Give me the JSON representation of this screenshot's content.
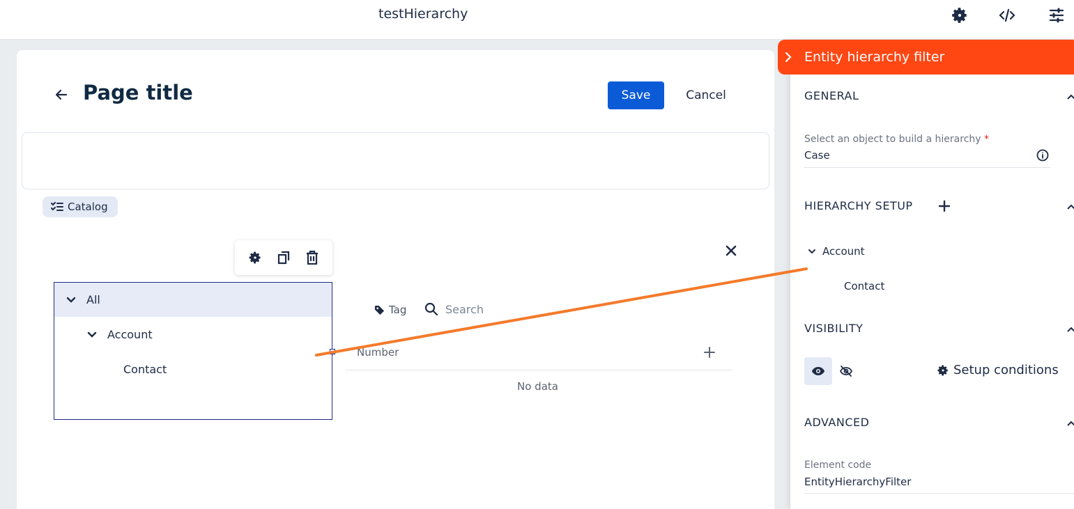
{
  "app": {
    "title": "testHierarchy"
  },
  "topbar": {
    "icons": [
      "gear-settings-icon",
      "code-icon",
      "sliders-icon"
    ]
  },
  "page": {
    "title": "Page title",
    "save_label": "Save",
    "cancel_label": "Cancel",
    "catalog_chip": "Catalog"
  },
  "tree": {
    "items": [
      {
        "label": "All",
        "expanded": true,
        "selected": true
      },
      {
        "label": "Account",
        "expanded": true
      },
      {
        "label": "Contact"
      }
    ]
  },
  "list": {
    "tag_label": "Tag",
    "search_placeholder": "Search",
    "column_header": "Number",
    "empty_text": "No data"
  },
  "panel": {
    "title": "Entity hierarchy filter",
    "header_color": "#ff4713",
    "general": {
      "title": "GENERAL",
      "object_label": "Select an object to build a hierarchy",
      "required_mark": "*",
      "object_value": "Case"
    },
    "hierarchy_setup": {
      "title": "HIERARCHY SETUP",
      "items": [
        "Account",
        "Contact"
      ]
    },
    "visibility": {
      "title": "VISIBILITY",
      "setup_conditions_label": "Setup conditions"
    },
    "advanced": {
      "title": "ADVANCED",
      "element_code_label": "Element code",
      "element_code_value": "EntityHierarchyFilter"
    }
  },
  "colors": {
    "accent": "#0b5bd7",
    "connector": "#f47a2a",
    "selection_border": "#1f2a8a"
  }
}
